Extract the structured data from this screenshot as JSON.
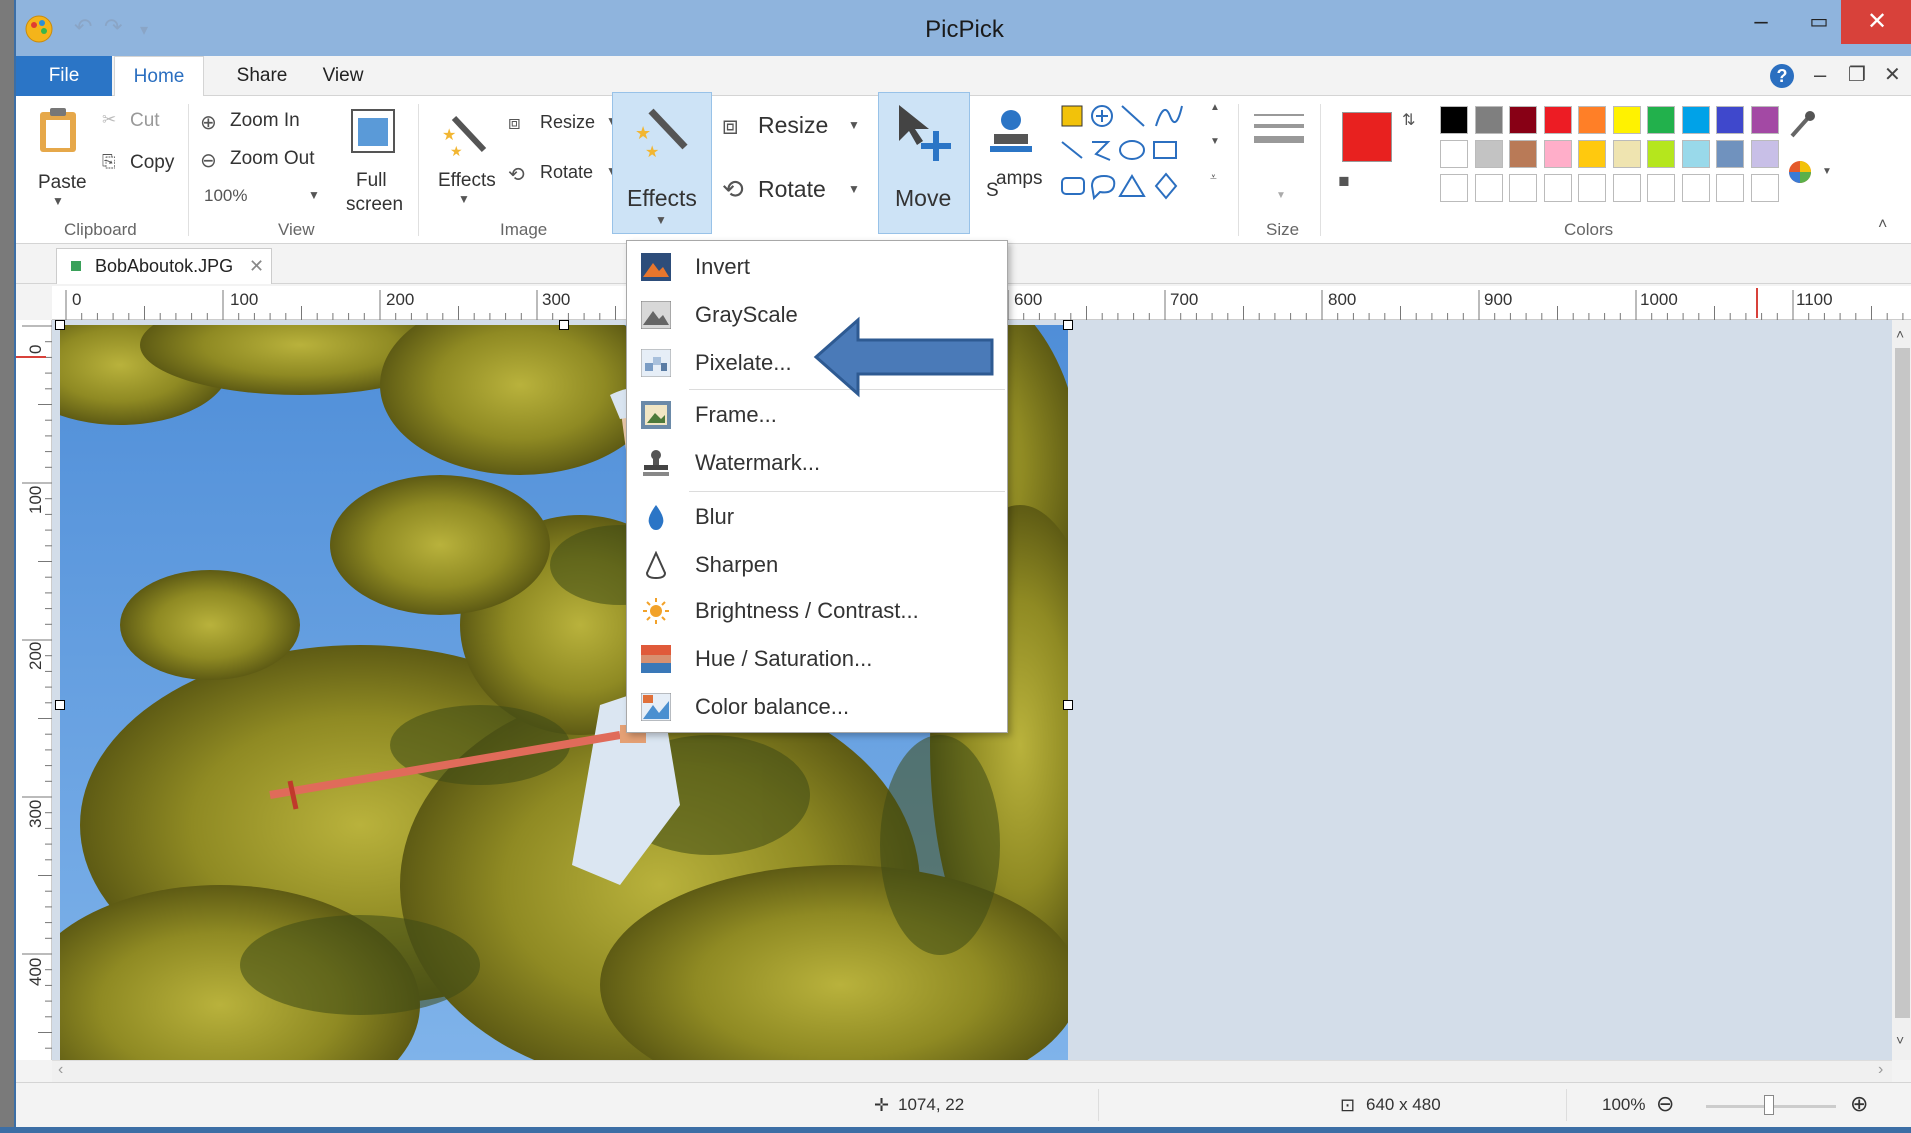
{
  "window": {
    "title": "PicPick"
  },
  "menu_tabs": [
    "File",
    "Home",
    "Share",
    "View"
  ],
  "ribbon": {
    "clipboard": {
      "paste": "Paste",
      "cut": "Cut",
      "copy": "Copy",
      "group": "Clipboard"
    },
    "view": {
      "zoom_in": "Zoom In",
      "zoom_out": "Zoom Out",
      "zoom_level": "100%",
      "full": "Full",
      "screen": "screen",
      "group": "View"
    },
    "image": {
      "effects": "Effects",
      "resize": "Resize",
      "rotate": "Rotate",
      "group": "Image"
    },
    "big": {
      "effects": "Effects",
      "resize": "Resize",
      "rotate": "Rotate",
      "move": "Move",
      "stamps": "amps",
      "stamps_s": "S"
    },
    "size_group": "Size",
    "colors_group": "Colors",
    "primary_color": "#e8211f",
    "palette_row1": [
      "#000000",
      "#7f7f7f",
      "#880015",
      "#ed1c24",
      "#ff7f27",
      "#fff200",
      "#22b14c",
      "#00a2e8",
      "#3f48cc",
      "#a349a4"
    ],
    "palette_row2": [
      "#ffffff",
      "#c3c3c3",
      "#b97a57",
      "#ffaec9",
      "#ffc90e",
      "#efe4b0",
      "#b5e61d",
      "#99d9ea",
      "#7092be",
      "#c8bfe7"
    ]
  },
  "document_tab": {
    "name": "BobAboutok.JPG"
  },
  "rulers": {
    "h_ticks": [
      "0",
      "100",
      "200",
      "300",
      "600",
      "700",
      "800",
      "900",
      "1000",
      "1100"
    ],
    "v_ticks": [
      "0",
      "100",
      "200",
      "300",
      "400"
    ]
  },
  "effects_menu": {
    "items": [
      "Invert",
      "GrayScale",
      "Pixelate...",
      "Frame...",
      "Watermark...",
      "Blur",
      "Sharpen",
      "Brightness / Contrast...",
      "Hue / Saturation...",
      "Color balance..."
    ]
  },
  "status": {
    "cursor_pos": "1074, 22",
    "image_size": "640 x 480",
    "zoom": "100%"
  }
}
